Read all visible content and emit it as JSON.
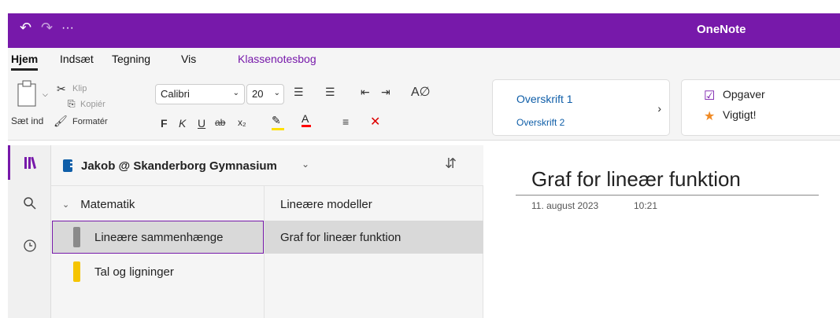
{
  "titlebar": {
    "app_title": "OneNote",
    "undo_icon": "undo-icon",
    "redo_icon": "redo-icon",
    "more": "···"
  },
  "tabs": {
    "home": "Hjem",
    "insert": "Indsæt",
    "draw": "Tegning",
    "view": "Vis",
    "class": "Klassenotesbog"
  },
  "ribbon": {
    "paste": "Sæt ind",
    "cut": "Klip",
    "copy": "Kopiér",
    "format": "Formatér",
    "font": "Calibri",
    "size": "20",
    "bold": "F",
    "italic": "K",
    "underline": "U",
    "strike": "ab",
    "subscript": "x₂",
    "styles": {
      "h1": "Overskrift 1",
      "h2": "Overskrift 2"
    },
    "tags": {
      "tasks": "Opgaver",
      "important": "Vigtigt!"
    }
  },
  "colors": {
    "accent": "#7719aa",
    "highlight": "#ffe000",
    "fontcolor": "#ff0000",
    "styleblue": "#0f5ea8"
  },
  "notebook": {
    "name": "Jakob @ Skanderborg Gymnasium"
  },
  "sections": [
    {
      "label": "Matematik"
    },
    {
      "label": "Lineære sammenhænge"
    },
    {
      "label": "Tal og ligninger"
    }
  ],
  "pages": [
    {
      "label": "Lineære modeller"
    },
    {
      "label": "Graf for lineær funktion"
    }
  ],
  "page": {
    "title": "Graf for lineær funktion",
    "date": "11. august 2023",
    "time": "10:21"
  }
}
